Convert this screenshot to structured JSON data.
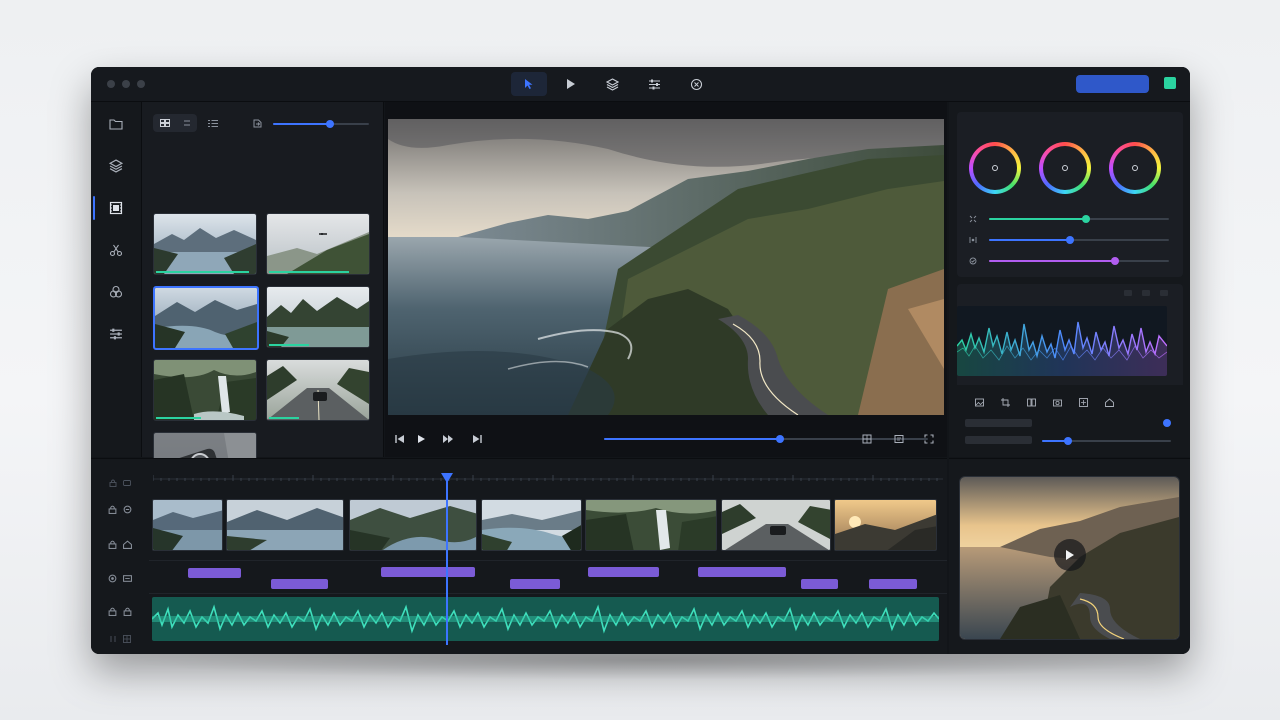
{
  "window": {
    "toolbar": {
      "tools": [
        {
          "name": "select-tool",
          "icon": "cursor-icon",
          "active": true
        },
        {
          "name": "play-tool",
          "icon": "play-icon",
          "active": false
        },
        {
          "name": "layers-tool",
          "icon": "layers-icon",
          "active": false
        },
        {
          "name": "adjust-tool",
          "icon": "sliders-icon",
          "active": false
        },
        {
          "name": "effects-tool",
          "icon": "record-icon",
          "active": false
        }
      ],
      "export_button_color": "#2f58c9",
      "status_color": "#2bd3a0"
    },
    "sidebar": {
      "items": [
        {
          "icon": "folder-icon",
          "active": false
        },
        {
          "icon": "layers-icon",
          "active": false
        },
        {
          "icon": "film-icon",
          "active": true
        },
        {
          "icon": "scissors-icon",
          "active": false
        },
        {
          "icon": "color-circles-icon",
          "active": false
        },
        {
          "icon": "sliders-icon",
          "active": false
        }
      ]
    },
    "media_browser": {
      "view_modes": [
        "grid-icon",
        "list-icon"
      ],
      "zoom_level": 0.6,
      "clips": [
        {
          "scene": "lake-mountains",
          "selected": false,
          "progress": 0.95
        },
        {
          "scene": "mountain-drone",
          "selected": false,
          "progress": 0.8
        },
        {
          "scene": "river-valley",
          "selected": true,
          "progress": 0.0
        },
        {
          "scene": "forest-lake",
          "selected": false,
          "progress": 0.4
        },
        {
          "scene": "waterfall",
          "selected": false,
          "progress": 0.45
        },
        {
          "scene": "road-car",
          "selected": false,
          "progress": 0.3
        },
        {
          "scene": "camera-closeup",
          "selected": false,
          "progress": 0.0
        }
      ]
    },
    "viewer": {
      "scene": "coastal-road-sunset",
      "playback_progress": 0.5,
      "transport": [
        "skip-back-icon",
        "play-icon",
        "fast-forward-icon",
        "skip-forward-icon"
      ],
      "tools": [
        "crop-icon",
        "safe-area-icon",
        "fullscreen-icon"
      ]
    },
    "color_panel": {
      "wheels": [
        "lift",
        "gamma",
        "gain"
      ],
      "sliders": [
        {
          "icon": "contrast-icon",
          "value": 0.55,
          "color": "#2bd3a0"
        },
        {
          "icon": "temperature-icon",
          "value": 0.45,
          "color": "#3d74ff"
        },
        {
          "icon": "saturation-icon",
          "value": 0.7,
          "color": "#b15df0"
        }
      ]
    },
    "scopes_panel": {
      "tools": [
        "image-icon",
        "crop-icon",
        "compare-icon",
        "camera-icon",
        "layer-icon",
        "home-icon"
      ],
      "slider_value": 0.3
    },
    "timeline": {
      "playhead_position": 0.25,
      "video_clips": [
        "lake",
        "lake-wide",
        "river-valley",
        "river-bend",
        "waterfall",
        "road-car",
        "sunset-mountains"
      ],
      "audio_color": "#2fbfa0",
      "subtitle_color": "#7b5bd6"
    },
    "output_preview": {
      "scene": "coastal-road-sunset"
    }
  }
}
